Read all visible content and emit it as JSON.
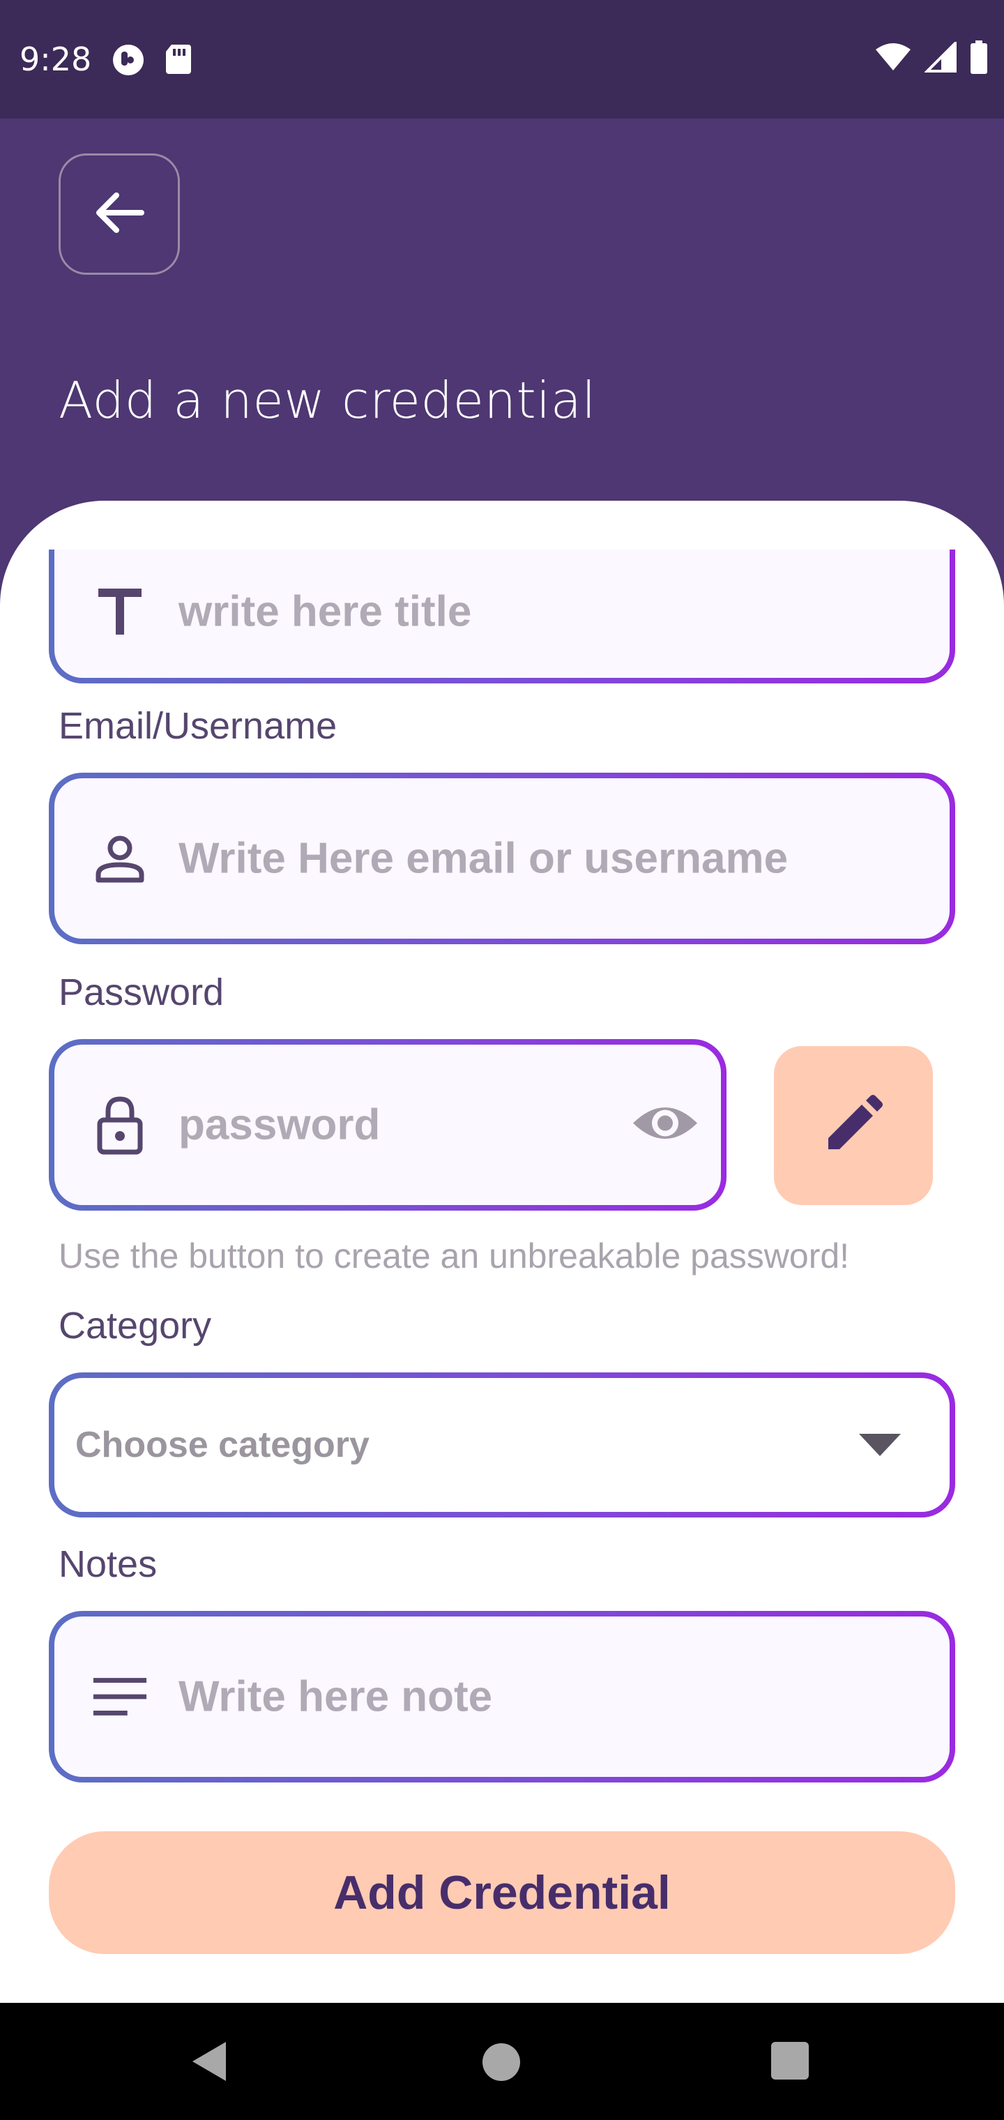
{
  "status_bar": {
    "time": "9:28",
    "left_icons": [
      "ring-icon",
      "sd-card-icon"
    ],
    "right_icons": [
      "wifi-icon",
      "cell-signal-icon",
      "battery-icon"
    ]
  },
  "header": {
    "back_icon": "arrow-left-icon",
    "title": "Add a new credential"
  },
  "form": {
    "title_field": {
      "icon": "text-t-icon",
      "placeholder": "write here title"
    },
    "email": {
      "label": "Email/Username",
      "icon": "person-icon",
      "placeholder": "Write Here email or username"
    },
    "password": {
      "label": "Password",
      "icon": "lock-icon",
      "placeholder": "password",
      "visibility_icon": "eye-icon",
      "generate_icon": "pencil-icon",
      "helper": "Use the button to create an unbreakable password!"
    },
    "category": {
      "label": "Category",
      "placeholder": "Choose category",
      "dropdown_icon": "caret-down-icon"
    },
    "notes": {
      "label": "Notes",
      "icon": "notes-lines-icon",
      "placeholder": "Write here note"
    },
    "submit_label": "Add Credential"
  },
  "nav_bar": {
    "items": [
      "nav-back-icon",
      "nav-home-icon",
      "nav-recents-icon"
    ]
  },
  "colors": {
    "header_bg": "#4e3772",
    "status_bg": "#3c2a58",
    "accent_peach": "#ffcbb3",
    "label_purple": "#56466e",
    "border_gradient_start": "#5c6ec4",
    "border_gradient_end": "#9a2ae0"
  }
}
